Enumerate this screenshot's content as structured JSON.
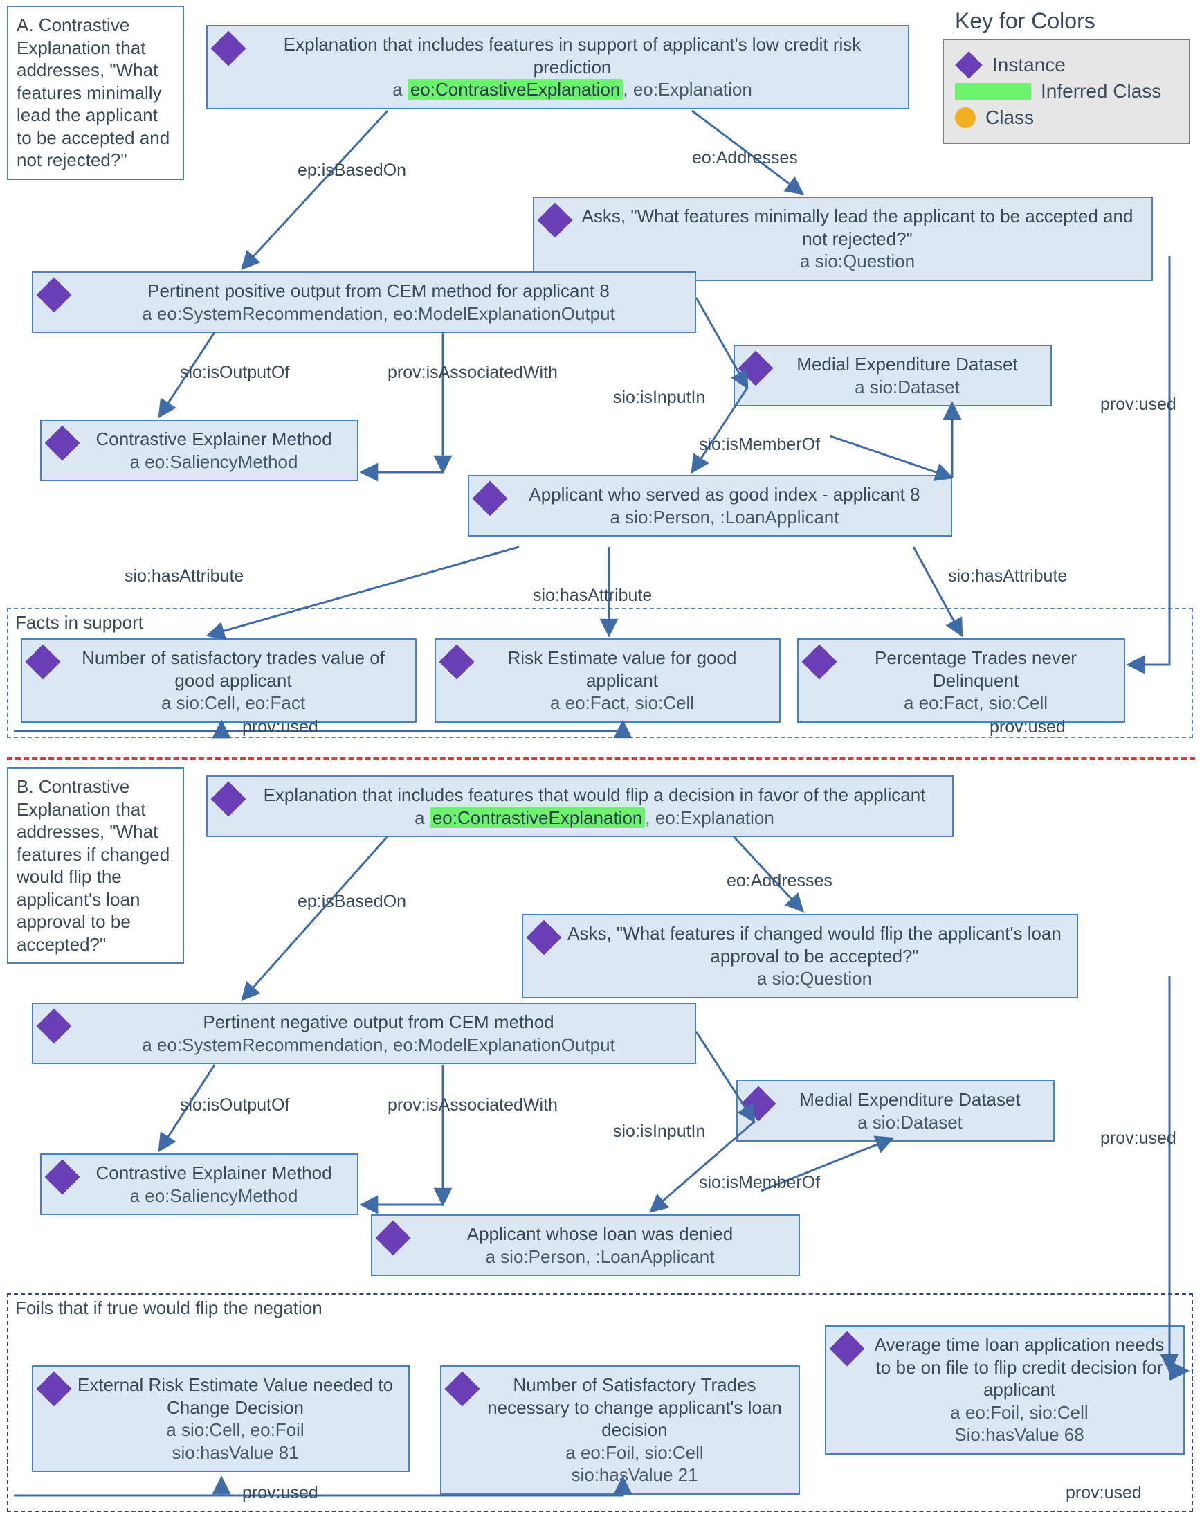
{
  "legend": {
    "title": "Key for Colors",
    "instance": "Instance",
    "inferred": "Inferred Class",
    "class": "Class"
  },
  "sectionA": {
    "label": "A. Contrastive Explanation that addresses, \"What features minimally lead the applicant to be accepted and not rejected?\"",
    "explanation": {
      "title": "Explanation that includes features in support of applicant's low credit risk prediction",
      "type_prefix": "a ",
      "type_inferred": "eo:ContrastiveExplanation",
      "type_suffix": ", eo:Explanation"
    },
    "question": {
      "title": "Asks, \"What features minimally lead the applicant to be accepted and not rejected?\"",
      "type": "a sio:Question"
    },
    "posOutput": {
      "title": "Pertinent positive output from CEM method for applicant 8",
      "type": "a eo:SystemRecommendation, eo:ModelExplanationOutput"
    },
    "method": {
      "title": "Contrastive Explainer Method",
      "type": "a eo:SaliencyMethod"
    },
    "dataset": {
      "title": "Medial Expenditure Dataset",
      "type": "a sio:Dataset"
    },
    "applicant": {
      "title": "Applicant who served as good index - applicant 8",
      "type": "a sio:Person, :LoanApplicant"
    },
    "factsTitle": "Facts in support",
    "fact1": {
      "title": "Number of satisfactory trades value of good applicant",
      "type": "a sio:Cell, eo:Fact"
    },
    "fact2": {
      "title": "Risk Estimate value for good applicant",
      "type": "a eo:Fact, sio:Cell"
    },
    "fact3": {
      "title": "Percentage Trades never Delinquent",
      "type": "a eo:Fact, sio:Cell"
    }
  },
  "sectionB": {
    "label": "B. Contrastive Explanation that addresses, \"What features if changed would flip the applicant's loan approval to be accepted?\"",
    "explanation": {
      "title": "Explanation that includes features that would flip a decision in favor of the applicant",
      "type_prefix": "a ",
      "type_inferred": "eo:ContrastiveExplanation",
      "type_suffix": ", eo:Explanation"
    },
    "question": {
      "title": "Asks, \"What features if changed would flip the applicant's loan approval to be accepted?\"",
      "type": "a sio:Question"
    },
    "negOutput": {
      "title": "Pertinent negative output from CEM method",
      "type": "a eo:SystemRecommendation, eo:ModelExplanationOutput"
    },
    "method": {
      "title": "Contrastive Explainer Method",
      "type": "a eo:SaliencyMethod"
    },
    "dataset": {
      "title": "Medial Expenditure Dataset",
      "type": "a sio:Dataset"
    },
    "applicant": {
      "title": "Applicant whose loan was denied",
      "type": "a sio:Person, :LoanApplicant"
    },
    "foilsTitle": "Foils that if true would flip the negation",
    "foil1": {
      "title": "External Risk Estimate Value needed to Change Decision",
      "type": "a sio:Cell, eo:Foil",
      "val": "sio:hasValue 81"
    },
    "foil2": {
      "title": "Number of Satisfactory Trades necessary to change applicant's loan decision",
      "type": "a eo:Foil, sio:Cell",
      "val": "sio:hasValue 21"
    },
    "foil3": {
      "title": "Average time loan application needs to be on file to flip credit decision for applicant",
      "type": "a eo:Foil, sio:Cell",
      "val": "Sio:hasValue 68"
    }
  },
  "edges": {
    "isBasedOn": "ep:isBasedOn",
    "addresses": "eo:Addresses",
    "isOutputOf": "sio:isOutputOf",
    "isAssociatedWith": "prov:isAssociatedWith",
    "isInputIn": "sio:isInputIn",
    "isMemberOf": "sio:isMemberOf",
    "hasAttribute": "sio:hasAttribute",
    "used": "prov:used"
  }
}
